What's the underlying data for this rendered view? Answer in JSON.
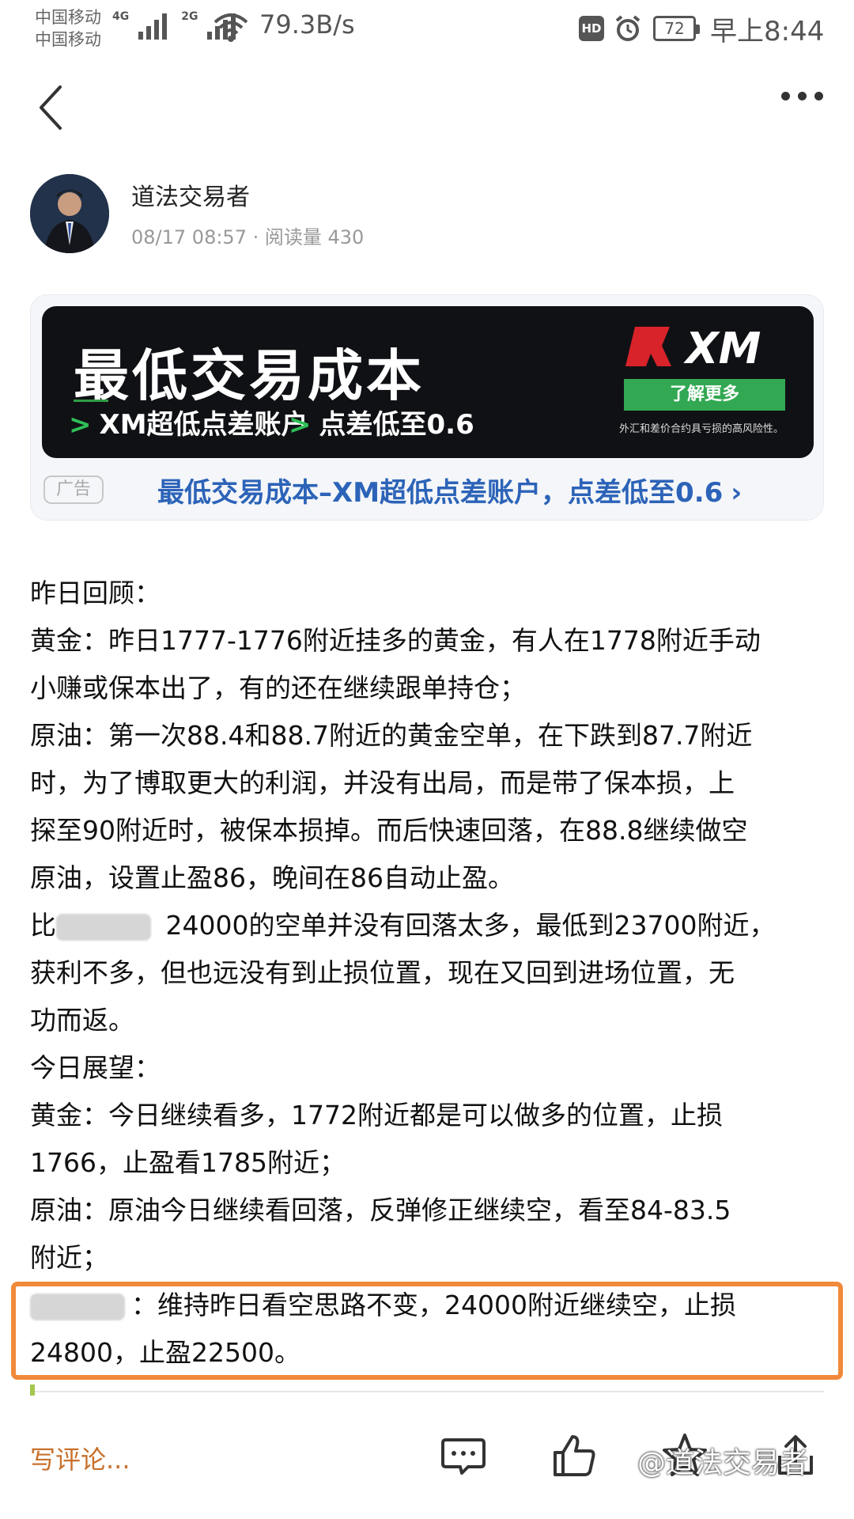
{
  "status_bar": {
    "carrier1": "中国移动",
    "carrier2": "中国移动",
    "net1": "4G",
    "net2": "2G",
    "speed": "79.3B/s",
    "hd": "HD",
    "battery": "72",
    "time": "早上8:44"
  },
  "author": {
    "name": "道法交易者",
    "meta": "08/17 08:57 · 阅读量 430"
  },
  "ad": {
    "title": "最低交易成本",
    "sub1": "XM超低点差账户",
    "sub2": "点差低至0.6",
    "chevron": ">",
    "brand": "XM",
    "button": "了解更多",
    "disclaimer": "外汇和差价合约具亏损的高风险性。",
    "badge": "广告",
    "link": "最低交易成本–XM超低点差账户，点差低至0.6",
    "link_arrow": "›"
  },
  "article": {
    "lines": [
      "昨日回顾：",
      "黄金：昨日1777-1776附近挂多的黄金，有人在1778附近手动",
      "小赚或保本出了，有的还在继续跟单持仓；",
      "原油：第一次88.4和88.7附近的黄金空单，在下跌到87.7附近",
      "时，为了博取更大的利润，并没有出局，而是带了保本损，上",
      "探至90附近时，被保本损掉。而后快速回落，在88.8继续做空",
      "原油，设置止盈86，晚间在86自动止盈。"
    ],
    "line_partial_a_prefix": "比",
    "line_partial_a_suffix": " 24000的空单并没有回落太多，最低到23700附近，",
    "lines2": [
      "获利不多，但也远没有到止损位置，现在又回到进场位置，无",
      "功而返。",
      "今日展望：",
      "黄金：今日继续看多，1772附近都是可以做多的位置，止损",
      "1766，止盈看1785附近；",
      "原油：原油今日继续看回落，反弹修正继续空，看至84-83.5",
      "附近；"
    ],
    "line_partial_b_suffix": "：维持昨日看空思路不变，24000附近继续空，止损",
    "last_line": "24800，止盈22500。"
  },
  "bottom_bar": {
    "write_comment": "写评论...",
    "watermark": "@道法交易者"
  },
  "colors": {
    "accent_orange": "#f08a3a",
    "ad_link_blue": "#2c63b8",
    "xm_green": "#32a852"
  }
}
